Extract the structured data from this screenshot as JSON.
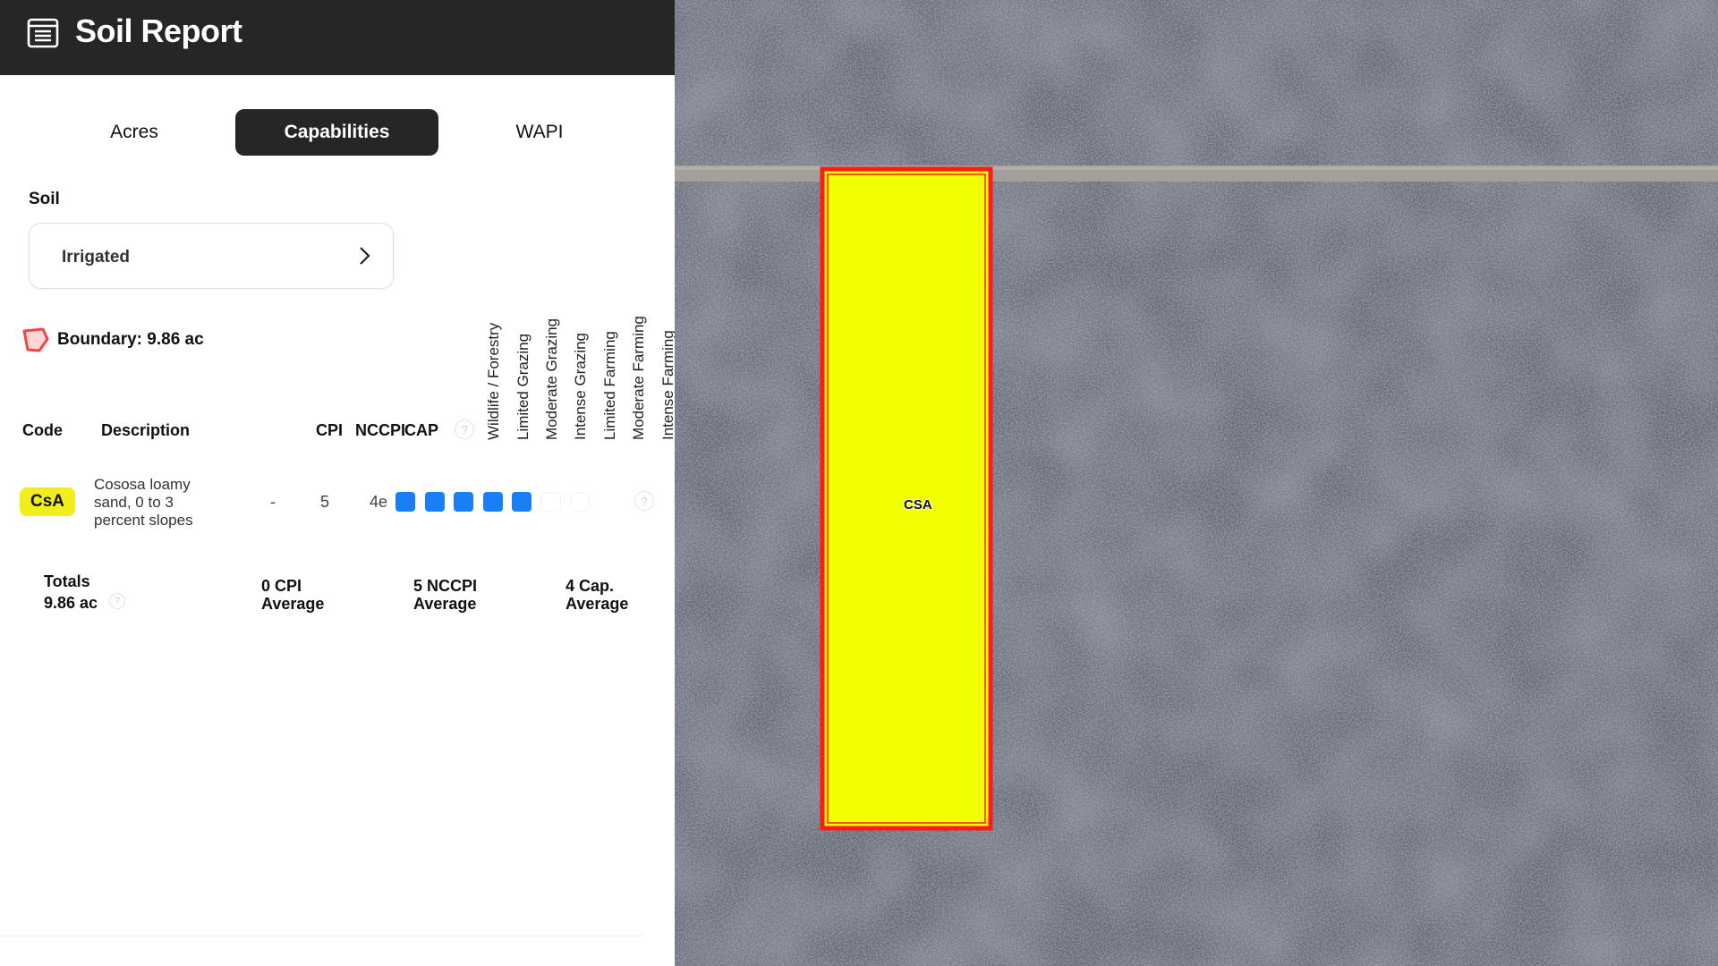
{
  "header": {
    "title": "Soil Report",
    "icon": "report-list-icon"
  },
  "tabs": [
    {
      "label": "Acres",
      "active": false
    },
    {
      "label": "Capabilities",
      "active": true
    },
    {
      "label": "WAPI",
      "active": false
    }
  ],
  "soil": {
    "label": "Soil",
    "selected": "Irrigated"
  },
  "boundary": {
    "text": "Boundary: 9.86 ac",
    "icon": "boundary-polygon-icon"
  },
  "table": {
    "headers": {
      "code": "Code",
      "description": "Description",
      "cpi": "CPI",
      "nccpi": "NCCPI",
      "cap": "CAP"
    },
    "capability_columns": [
      "Wildlife / Forestry",
      "Limited Grazing",
      "Moderate Grazing",
      "Intense Grazing",
      "Limited Farming",
      "Moderate Farming",
      "Intense Farming"
    ],
    "rows": [
      {
        "code": "CsA",
        "description": "Cososa loamy sand, 0 to 3 percent slopes",
        "cpi": "-",
        "nccpi": "5",
        "cap": "4e",
        "capability_levels_filled": 5,
        "capability_levels_total": 7
      }
    ]
  },
  "totals": {
    "title": "Totals",
    "acres": "9.86 ac",
    "cpi_avg_1": "0 CPI",
    "cpi_avg_2": "Average",
    "nccpi_avg_1": "5 NCCPI",
    "nccpi_avg_2": "Average",
    "cap_avg_1": "4 Cap.",
    "cap_avg_2": "Average"
  },
  "map": {
    "parcel_label": "CSA",
    "parcel_fill": "#f2ff00",
    "parcel_border": "#ff1a1a"
  },
  "colors": {
    "accent": "#1a7ef5",
    "header_bg": "#262626",
    "badge": "#f2ee1b"
  }
}
